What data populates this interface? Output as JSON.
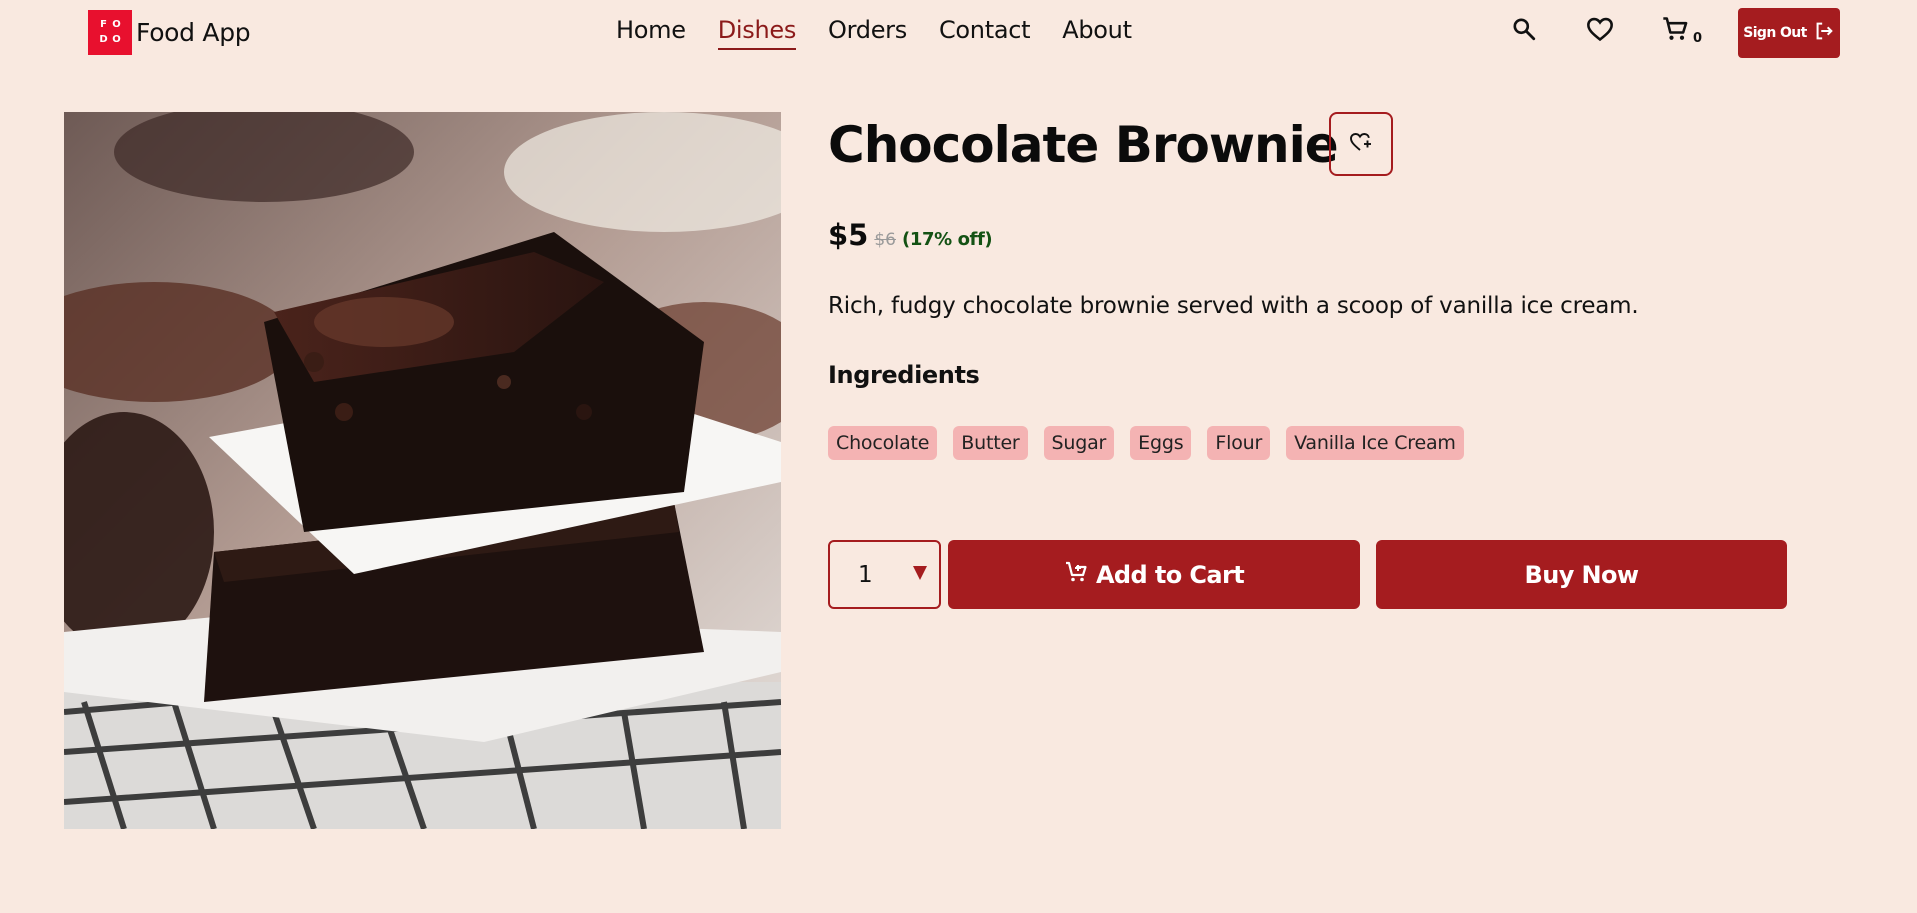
{
  "brand": {
    "logo_letters": [
      "F",
      "O",
      "D",
      "O"
    ],
    "name": "Food App"
  },
  "nav": {
    "items": [
      {
        "label": "Home",
        "active": false
      },
      {
        "label": "Dishes",
        "active": true
      },
      {
        "label": "Orders",
        "active": false
      },
      {
        "label": "Contact",
        "active": false
      },
      {
        "label": "About",
        "active": false
      }
    ]
  },
  "header_actions": {
    "search_icon": "search-icon",
    "wishlist_icon": "heart-icon",
    "cart_icon": "cart-icon",
    "cart_count": "0",
    "signout_label": "Sign Out",
    "signout_icon": "logout-icon"
  },
  "dish": {
    "title": "Chocolate Brownie",
    "price_now": "$5",
    "price_old": "$6",
    "discount": "(17% off)",
    "description": "Rich, fudgy chocolate brownie served with a scoop of vanilla ice cream.",
    "ingredients_heading": "Ingredients",
    "ingredients": [
      "Chocolate",
      "Butter",
      "Sugar",
      "Eggs",
      "Flour",
      "Vanilla Ice Cream"
    ],
    "image_subject": "chocolate-brownie-photo"
  },
  "purchase": {
    "quantity": "1",
    "add_to_cart_label": "Add to Cart",
    "buy_now_label": "Buy Now"
  },
  "colors": {
    "background": "#f9e9e0",
    "accent": "#a51c1f",
    "logo_red": "#e8102e",
    "tag_bg": "#f4b3b3",
    "discount_green": "#145214"
  }
}
